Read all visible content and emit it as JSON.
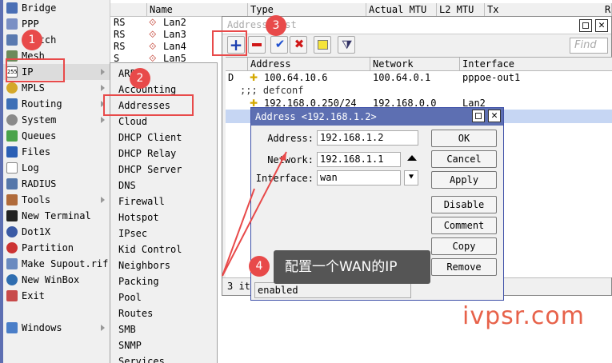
{
  "sidebar": {
    "items": [
      {
        "label": "Bridge",
        "icon": "bridge-icon"
      },
      {
        "label": "PPP",
        "icon": "ppp-icon"
      },
      {
        "label": "Switch",
        "icon": "switch-icon"
      },
      {
        "label": "Mesh",
        "icon": "mesh-icon"
      },
      {
        "label": "IP",
        "icon": "ip-icon"
      },
      {
        "label": "MPLS",
        "icon": "mpls-icon"
      },
      {
        "label": "Routing",
        "icon": "routing-icon"
      },
      {
        "label": "System",
        "icon": "gear-icon"
      },
      {
        "label": "Queues",
        "icon": "queues-icon"
      },
      {
        "label": "Files",
        "icon": "folder-icon"
      },
      {
        "label": "Log",
        "icon": "log-icon"
      },
      {
        "label": "RADIUS",
        "icon": "radius-icon"
      },
      {
        "label": "Tools",
        "icon": "tools-icon"
      },
      {
        "label": "New Terminal",
        "icon": "terminal-icon"
      },
      {
        "label": "Dot1X",
        "icon": "dot1x-icon"
      },
      {
        "label": "Partition",
        "icon": "partition-icon"
      },
      {
        "label": "Make Supout.rif",
        "icon": "supout-icon"
      },
      {
        "label": "New WinBox",
        "icon": "winbox-icon"
      },
      {
        "label": "Exit",
        "icon": "exit-icon"
      },
      {
        "label": "Windows",
        "icon": "windows-icon"
      }
    ]
  },
  "ip_submenu": {
    "items": [
      "ARP",
      "Accounting",
      "Addresses",
      "Cloud",
      "DHCP Client",
      "DHCP Relay",
      "DHCP Server",
      "DNS",
      "Firewall",
      "Hotspot",
      "IPsec",
      "Kid Control",
      "Neighbors",
      "Packing",
      "Pool",
      "Routes",
      "SMB",
      "SNMP",
      "Services"
    ]
  },
  "interfaces_table": {
    "columns": [
      "Name",
      "Type",
      "Actual MTU",
      "L2 MTU",
      "Tx"
    ],
    "rows": [
      {
        "flag": "RS",
        "name": "Lan2"
      },
      {
        "flag": "RS",
        "name": "Lan3"
      },
      {
        "flag": "RS",
        "name": "Lan4"
      },
      {
        "flag": "S",
        "name": "Lan5"
      }
    ],
    "corner_label": "R"
  },
  "address_list": {
    "title": "Address List",
    "find_placeholder": "Find",
    "columns": [
      "Address",
      "Network",
      "Interface"
    ],
    "rows": [
      {
        "flag": "D",
        "address": "100.64.10.6",
        "network": "100.64.0.1",
        "interface": "pppoe-out1"
      },
      {
        "comment": ";;; defconf"
      },
      {
        "flag": "",
        "address": "192.168.0.250/24",
        "network": "192.168.0.0",
        "interface": "Lan2"
      }
    ],
    "status": "3 it"
  },
  "dialog": {
    "title": "Address <192.168.1.2>",
    "address_label": "Address:",
    "address_value": "192.168.1.2",
    "network_label": "Network:",
    "network_value": "192.168.1.1",
    "interface_label": "Interface:",
    "interface_value": "wan",
    "buttons": [
      "OK",
      "Cancel",
      "Apply",
      "Disable",
      "Comment",
      "Copy",
      "Remove"
    ],
    "status": "enabled"
  },
  "annotations": {
    "badges": [
      "1",
      "2",
      "3",
      "4"
    ],
    "callout": "配置一个WAN的IP",
    "accent_color": "#e84a4a"
  },
  "watermark": "ivpsr.com"
}
